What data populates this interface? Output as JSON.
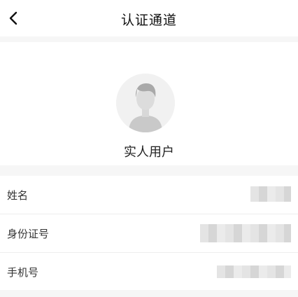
{
  "header": {
    "title": "认证通道",
    "back_icon": "chevron-left-icon"
  },
  "profile": {
    "avatar_icon": "default-avatar-icon",
    "user_type": "实人用户"
  },
  "fields": [
    {
      "label": "姓名"
    },
    {
      "label": "身份证号"
    },
    {
      "label": "手机号"
    }
  ],
  "colors": {
    "background": "#f6f6f6",
    "card": "#ffffff",
    "text": "#222222"
  }
}
